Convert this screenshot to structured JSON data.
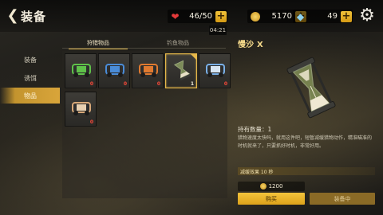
{
  "header": {
    "title": "装备",
    "health": "46/50",
    "gold": "5170",
    "diamonds": "49",
    "timer": "04:21"
  },
  "nav": {
    "items": [
      {
        "label": "装备",
        "active": false
      },
      {
        "label": "诱饵",
        "active": false
      },
      {
        "label": "物品",
        "active": true
      }
    ]
  },
  "tabs": [
    {
      "label": "狩猎物品",
      "active": true
    },
    {
      "label": "钓鱼物品",
      "active": false
    }
  ],
  "items": [
    {
      "name": "green-car",
      "count": "0",
      "color": "#5fc24a",
      "selected": false
    },
    {
      "name": "blue-car",
      "count": "0",
      "color": "#4a8cd8",
      "selected": false
    },
    {
      "name": "orange-car",
      "count": "0",
      "color": "#e07a30",
      "selected": false
    },
    {
      "name": "hourglass",
      "count": "1",
      "color": "#7a9a50",
      "selected": true
    },
    {
      "name": "blue-white-car",
      "count": "0",
      "color": "#7ab0e8",
      "selected": false
    },
    {
      "name": "tan-car",
      "count": "0",
      "color": "#d8a878",
      "selected": false
    }
  ],
  "detail": {
    "name": "慢沙",
    "name_suffix": "X",
    "owned": "持有数量：1",
    "description": "猎物速度太快吗，就用这件吧，短暂减缓猎物动作，精准瞄准的时机就来了，只要抓好时机，非常好用。",
    "effect": "减缓效果 10 秒",
    "price": "1200",
    "buy_label": "购买",
    "equip_label": "装备中"
  },
  "colors": {
    "accent": "#d9a53a",
    "count_zero": "#ff4a3a"
  }
}
